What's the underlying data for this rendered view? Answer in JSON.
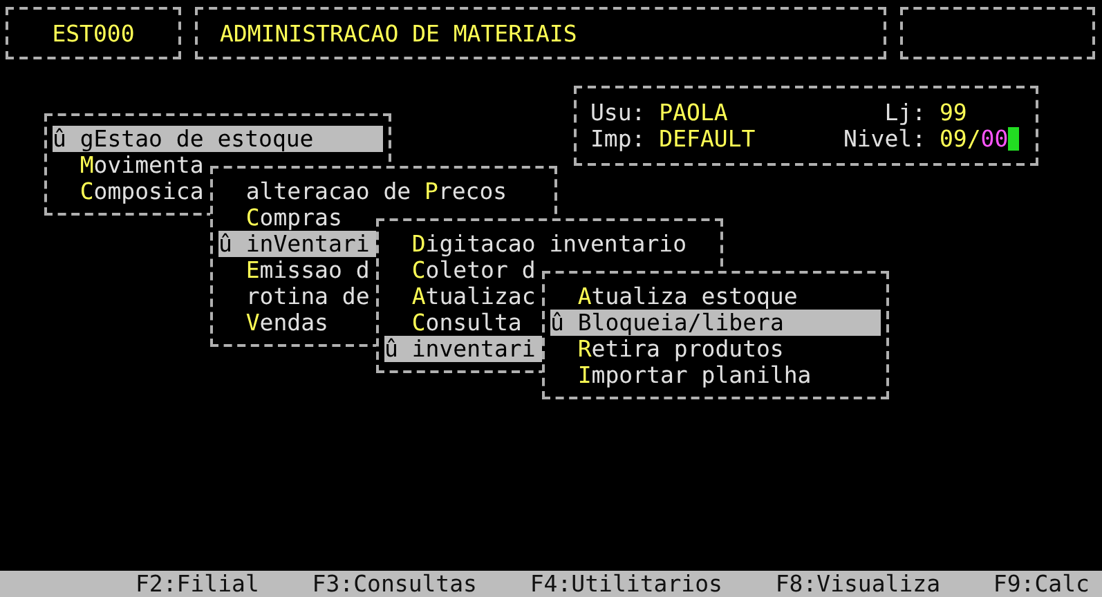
{
  "header": {
    "code": "EST000",
    "title": "ADMINISTRACAO DE MATERIAIS"
  },
  "info": {
    "rows": [
      {
        "label": "Usu:",
        "value": "PAOLA",
        "right_label": "Lj:",
        "right_value": "99"
      },
      {
        "label": "Imp:",
        "value": "DEFAULT",
        "right_label": "Nivel:",
        "right_value": "09/*00*"
      }
    ]
  },
  "menus": [
    {
      "items": [
        {
          "text": "û gEstao de estoque",
          "selected": true
        },
        {
          "text": "**M**ovimenta",
          "selected": false
        },
        {
          "text": "**C**omposica",
          "selected": false
        }
      ]
    },
    {
      "items": [
        {
          "text": "alteracao de **P**recos",
          "selected": false
        },
        {
          "text": "**C**ompras",
          "selected": false
        },
        {
          "text": "û inVentari",
          "selected": true
        },
        {
          "text": "**E**missao d",
          "selected": false
        },
        {
          "text": "rotina de",
          "selected": false
        },
        {
          "text": "**V**endas",
          "selected": false
        }
      ]
    },
    {
      "items": [
        {
          "text": "**D**igitacao inventario",
          "selected": false
        },
        {
          "text": "**C**oletor d",
          "selected": false
        },
        {
          "text": "**A**tualizac",
          "selected": false
        },
        {
          "text": "**C**onsulta",
          "selected": false
        },
        {
          "text": "û inventari",
          "selected": true
        }
      ]
    },
    {
      "items": [
        {
          "text": "**A**tualiza estoque",
          "selected": false
        },
        {
          "text": "û Bloqueia/libera",
          "selected": true
        },
        {
          "text": "**R**etira produtos",
          "selected": false
        },
        {
          "text": "**I**mportar planilha",
          "selected": false
        }
      ]
    }
  ],
  "function_keys": [
    "F2:Filial",
    "F3:Consultas",
    "F4:Utilitarios",
    "F8:Visualiza",
    "F9:Calc"
  ]
}
